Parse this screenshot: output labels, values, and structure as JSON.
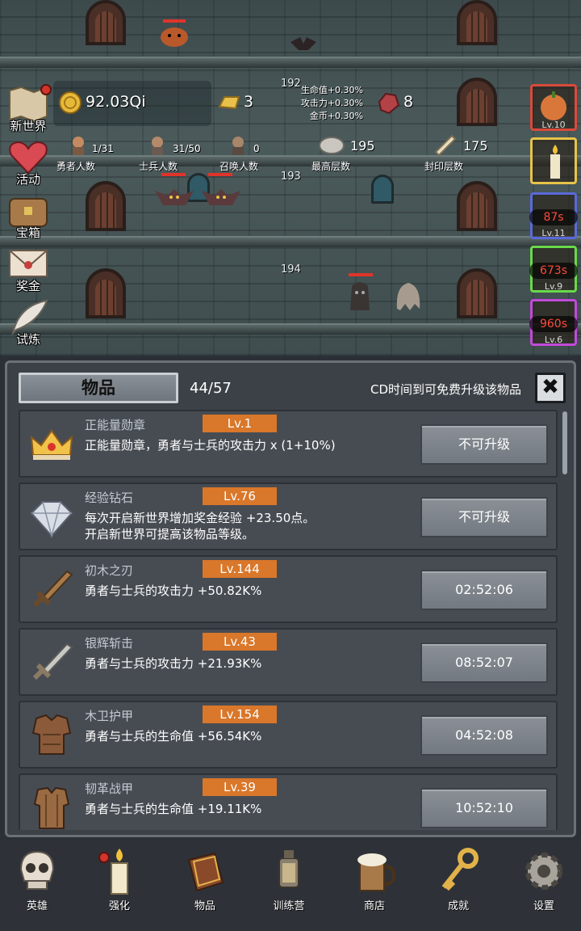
{
  "scene": {
    "floors": [
      "192",
      "193",
      "194"
    ],
    "resources": {
      "gold": "92.03Qi",
      "gold_bars": "3",
      "gems": "8"
    },
    "bonuses": [
      "生命值+0.30%",
      "攻击力+0.30%",
      "金币+0.30%"
    ],
    "counts": [
      {
        "value": "1/31",
        "label": "勇者人数"
      },
      {
        "value": "31/50",
        "label": "士兵人数"
      },
      {
        "value": "0",
        "label": "召唤人数"
      }
    ],
    "records": [
      {
        "value": "195",
        "label": "最高层数"
      },
      {
        "value": "175",
        "label": "封印层数"
      }
    ],
    "left_menu": [
      "新世界",
      "活动",
      "宝箱",
      "奖金",
      "试炼"
    ],
    "boosts": [
      {
        "timer": "",
        "level": "Lv.10"
      },
      {
        "timer": "",
        "level": ""
      },
      {
        "timer": "87s",
        "level": "Lv.11"
      },
      {
        "timer": "673s",
        "level": "Lv.9"
      },
      {
        "timer": "960s",
        "level": "Lv.6"
      }
    ]
  },
  "panel": {
    "title": "物品",
    "count": "44/57",
    "cd_note": "CD时间到可免费升级该物品",
    "close_label": "✖",
    "items": [
      {
        "name": "正能量勋章",
        "level": "Lv.1",
        "desc": [
          "正能量勋章，勇者与士兵的攻击力 x (1+10%)"
        ],
        "button": "不可升级",
        "icon": "crown-icon"
      },
      {
        "name": "经验钻石",
        "level": "Lv.76",
        "desc": [
          "每次开启新世界增加奖金经验 +23.50点。",
          "开启新世界可提高该物品等级。"
        ],
        "button": "不可升级",
        "icon": "diamond-icon"
      },
      {
        "name": "初木之刃",
        "level": "Lv.144",
        "desc": [
          "勇者与士兵的攻击力 +50.82K%"
        ],
        "button": "02:52:06",
        "icon": "wooden-sword-icon"
      },
      {
        "name": "银辉斩击",
        "level": "Lv.43",
        "desc": [
          "勇者与士兵的攻击力 +21.93K%"
        ],
        "button": "08:52:07",
        "icon": "silver-sword-icon"
      },
      {
        "name": "木卫护甲",
        "level": "Lv.154",
        "desc": [
          "勇者与士兵的生命值 +56.54K%"
        ],
        "button": "04:52:08",
        "icon": "wooden-armor-icon"
      },
      {
        "name": "韧革战甲",
        "level": "Lv.39",
        "desc": [
          "勇者与士兵的生命值 +19.11K%"
        ],
        "button": "10:52:10",
        "icon": "leather-armor-icon"
      }
    ]
  },
  "nav": [
    {
      "label": "英雄",
      "icon": "skull-icon"
    },
    {
      "label": "强化",
      "icon": "candle-icon"
    },
    {
      "label": "物品",
      "icon": "book-icon"
    },
    {
      "label": "训练营",
      "icon": "lantern-icon"
    },
    {
      "label": "商店",
      "icon": "beer-mug-icon"
    },
    {
      "label": "成就",
      "icon": "key-icon"
    },
    {
      "label": "设置",
      "icon": "gear-icon"
    }
  ]
}
